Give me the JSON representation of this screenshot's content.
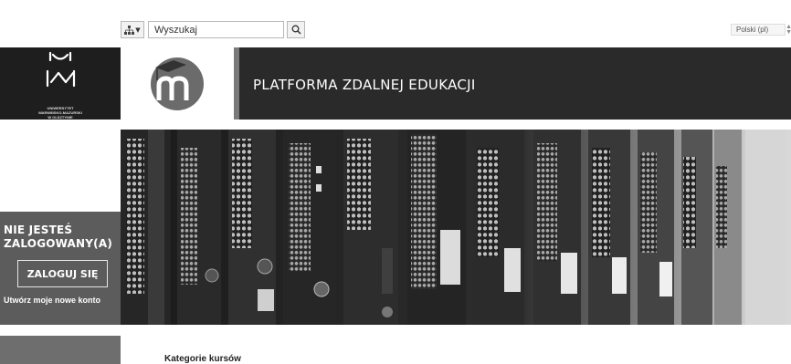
{
  "search": {
    "placeholder": "Wyszukaj"
  },
  "language": {
    "selected": "Polski (pl)"
  },
  "university": {
    "line1": "UNIWERSYTET",
    "line2": "WARMIŃSKO-MAZURSKI",
    "line3": "W OLSZTYNIE"
  },
  "header": {
    "title": "PLATFORMA ZDALNEJ EDUKACJI"
  },
  "login": {
    "heading_line1": "NIE JESTEŚ",
    "heading_line2": "ZALOGOWANY(A)",
    "button_label": "ZALOGUJ SIĘ",
    "create_account": "Utwórz moje nowe konto"
  },
  "main": {
    "section_title": "Kategorie kursów"
  },
  "icons": {
    "nav": "sitemap-icon",
    "search": "magnifier-icon",
    "logo": "moodle-logo",
    "university": "uwm-logo"
  },
  "colors": {
    "header_dark": "#2a2a2a",
    "logo_dark": "#1e1e1e",
    "sidebar": "#5c5c5c",
    "accent": "#7a7a7a"
  }
}
